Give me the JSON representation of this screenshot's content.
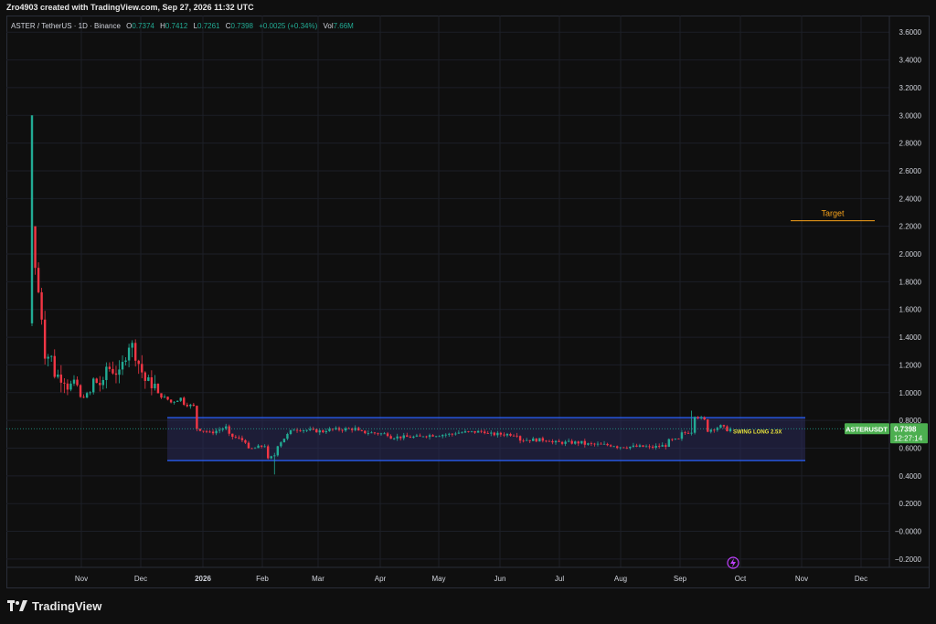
{
  "header": {
    "watermark_text": "Zro4903 created with TradingView.com, Sep 27, 2026 11:32 UTC"
  },
  "legend": {
    "symbol": "ASTER / TetherUS · 1D · Binance",
    "open_label": "O",
    "open": "0.7374",
    "high_label": "H",
    "high": "0.7412",
    "low_label": "L",
    "low": "0.7261",
    "close_label": "C",
    "close": "0.7398",
    "change": "+0.0025 (+0.34%)",
    "volume_label": "Vol",
    "volume": "7.66M"
  },
  "price_badge": {
    "symbol": "ASTERUSDT",
    "price": "0.7398",
    "countdown": "12:27:14"
  },
  "annotations": {
    "target_label": "Target",
    "zone_label": "SWING LONG 2.5X"
  },
  "footer": {
    "brand": "TradingView"
  },
  "chart_data": {
    "type": "candlestick",
    "instrument": "ASTER / TetherUS",
    "interval": "1D",
    "exchange": "Binance",
    "y_axis": {
      "ticks": [
        "3.6000",
        "3.4000",
        "3.2000",
        "3.0000",
        "2.8000",
        "2.6000",
        "2.4000",
        "2.2000",
        "2.0000",
        "1.8000",
        "1.6000",
        "1.4000",
        "1.2000",
        "1.0000",
        "0.8000",
        "0.6000",
        "0.4000",
        "0.2000",
        "−0.0000",
        "−0.2000"
      ],
      "range": [
        -0.26,
        3.72
      ]
    },
    "x_axis": {
      "labels": [
        "Nov",
        "Dec",
        "2026",
        "Feb",
        "Mar",
        "Apr",
        "May",
        "Jun",
        "Jul",
        "Aug",
        "Sep",
        "Oct",
        "Nov",
        "Dec"
      ]
    },
    "price_path": [
      [
        0,
        1.5,
        3.0
      ],
      [
        1,
        2.2,
        1.9
      ],
      [
        3,
        1.55,
        1.3
      ],
      [
        6,
        1.25,
        1.15
      ],
      [
        10,
        1.1,
        1.05
      ],
      [
        14,
        1.05,
        0.95
      ],
      [
        18,
        1.0,
        1.1
      ],
      [
        22,
        1.05,
        1.2
      ],
      [
        26,
        1.15,
        1.05
      ],
      [
        30,
        1.35,
        1.4
      ],
      [
        34,
        1.15,
        1.1
      ],
      [
        38,
        1.05,
        1.0
      ],
      [
        42,
        0.95,
        0.92
      ],
      [
        46,
        0.96,
        0.93
      ],
      [
        50,
        0.9,
        0.75
      ],
      [
        54,
        0.72,
        0.7
      ],
      [
        60,
        0.75,
        0.7
      ],
      [
        66,
        0.65,
        0.58
      ],
      [
        72,
        0.62,
        0.5
      ],
      [
        75,
        0.55,
        0.6
      ],
      [
        80,
        0.72,
        0.74
      ],
      [
        90,
        0.72,
        0.73
      ],
      [
        100,
        0.74,
        0.72
      ],
      [
        110,
        0.7,
        0.68
      ],
      [
        120,
        0.68,
        0.69
      ],
      [
        130,
        0.7,
        0.71
      ],
      [
        140,
        0.72,
        0.7
      ],
      [
        150,
        0.7,
        0.66
      ],
      [
        160,
        0.66,
        0.64
      ],
      [
        170,
        0.64,
        0.63
      ],
      [
        180,
        0.62,
        0.61
      ],
      [
        190,
        0.61,
        0.6
      ],
      [
        196,
        0.62,
        0.65
      ],
      [
        200,
        0.66,
        0.7
      ],
      [
        204,
        0.72,
        0.85
      ],
      [
        208,
        0.8,
        0.72
      ],
      [
        212,
        0.75,
        0.77
      ],
      [
        216,
        0.72,
        0.7398
      ]
    ],
    "zone": {
      "label": "SWING LONG 2.5X",
      "top": 0.82,
      "bottom": 0.51
    },
    "target": {
      "label": "Target",
      "price": 2.24
    },
    "last_price": 0.7398,
    "colors": {
      "up": "#22ab94",
      "down": "#f23645",
      "zone_border": "#2962ff",
      "zone_fill": "#2a2a5a",
      "target": "#f7a21b",
      "badge": "#4caf50",
      "zone_text": "#e8e33a"
    }
  }
}
